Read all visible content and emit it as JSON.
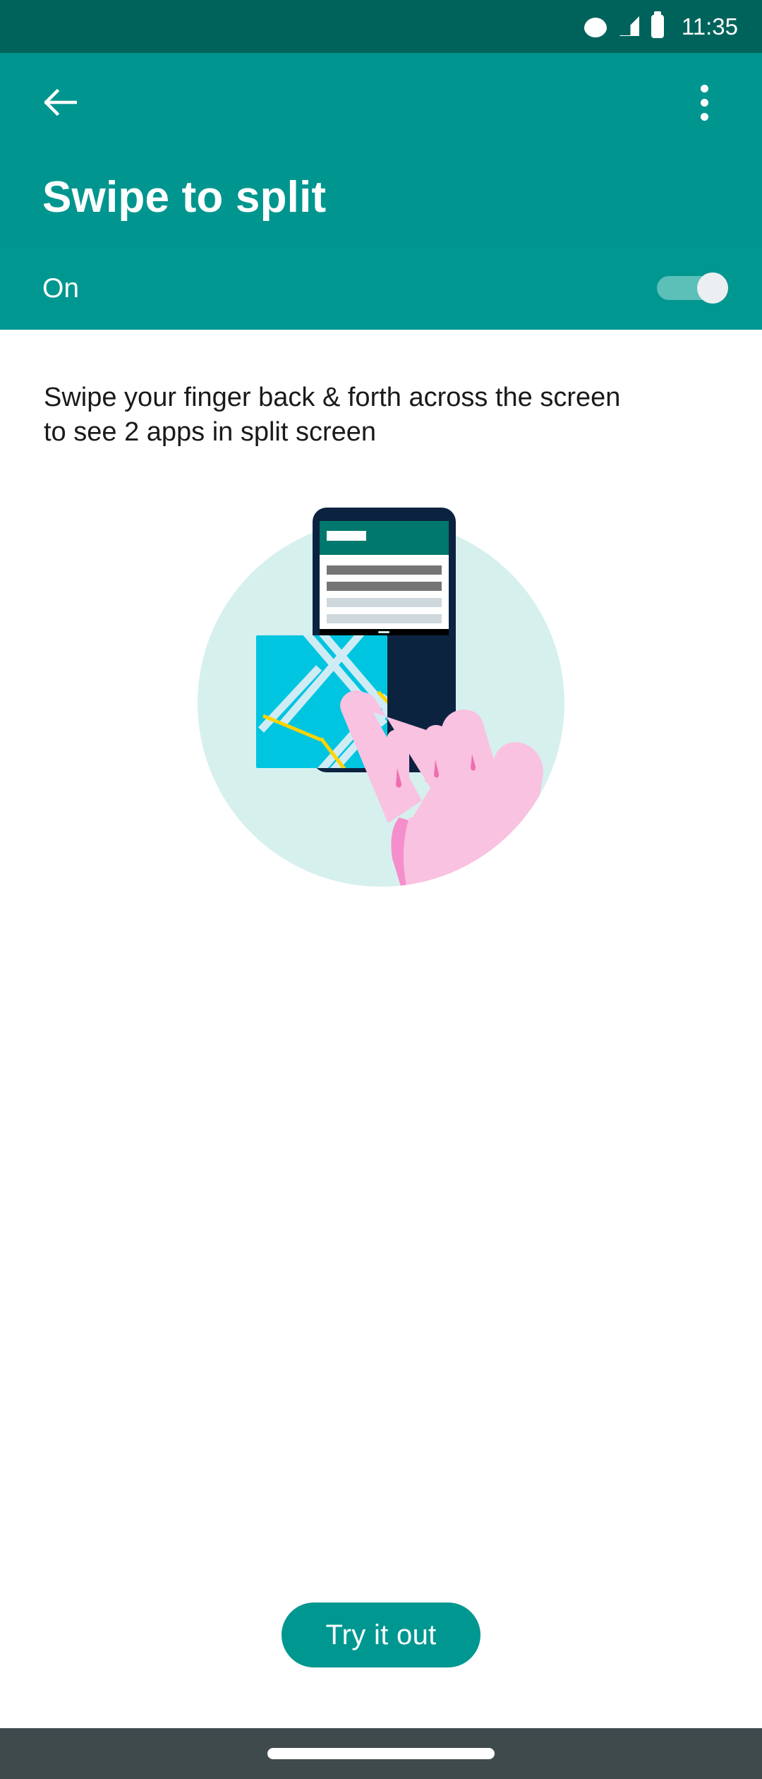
{
  "status_bar": {
    "time": "11:35",
    "icons": [
      "wifi-icon",
      "signal-icon",
      "battery-icon"
    ],
    "background_color": "#00635B"
  },
  "app_bar": {
    "title": "Swipe to split",
    "back_icon": "back-arrow-icon",
    "overflow_icon": "overflow-menu-icon",
    "background_color": "#00968F"
  },
  "toggle_row": {
    "label": "On",
    "state": "on",
    "track_color": "#5CBFB8",
    "thumb_color": "#ECEFF1",
    "background_color": "#009790"
  },
  "main": {
    "description": "Swipe your finger back & forth across the screen to see 2 apps in split screen",
    "illustration": {
      "name": "split-screen-swipe-illustration",
      "circle_color": "#D6F0EE",
      "phone_frame_color": "#0C2340",
      "top_app_bar_color": "#00786D",
      "top_app_surface_color": "#FFFFFF",
      "list_bar_dark_color": "#757575",
      "list_bar_light_color": "#CFD8DC",
      "divider_color": "#000000",
      "map_color": "#00C5E0",
      "map_road_color": "#CFECF5",
      "map_highway_color": "#FFD400",
      "hand_color": "#F9C2E0",
      "hand_shadow_color": "#F58FCB"
    }
  },
  "cta": {
    "label": "Try it out",
    "background_color": "#009790",
    "text_color": "#FFFFFF"
  },
  "nav_bar": {
    "background_color": "#3F4A4D",
    "gesture_pill": "home-gesture-pill"
  }
}
